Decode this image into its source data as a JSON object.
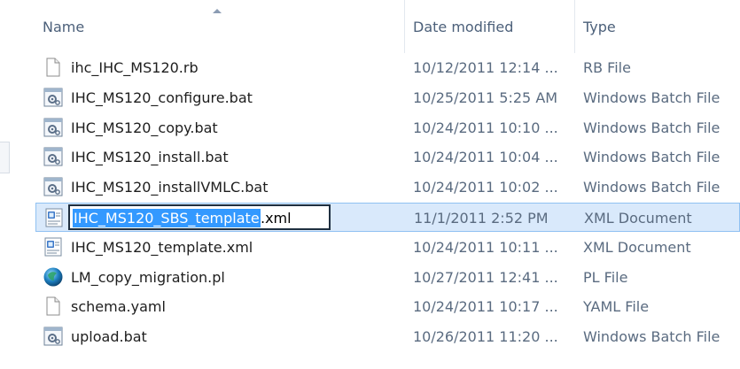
{
  "columns": {
    "name": "Name",
    "date_modified": "Date modified",
    "type": "Type"
  },
  "files": [
    {
      "name": "ihc_IHC_MS120.rb",
      "date": "10/12/2011 12:14 ...",
      "type": "RB File",
      "icon": "blank-file-icon"
    },
    {
      "name": "IHC_MS120_configure.bat",
      "date": "10/25/2011 5:25 AM",
      "type": "Windows Batch File",
      "icon": "batch-file-icon"
    },
    {
      "name": "IHC_MS120_copy.bat",
      "date": "10/24/2011 10:10 ...",
      "type": "Windows Batch File",
      "icon": "batch-file-icon"
    },
    {
      "name": "IHC_MS120_install.bat",
      "date": "10/24/2011 10:04 ...",
      "type": "Windows Batch File",
      "icon": "batch-file-icon"
    },
    {
      "name": "IHC_MS120_installVMLC.bat",
      "date": "10/24/2011 10:02 ...",
      "type": "Windows Batch File",
      "icon": "batch-file-icon"
    },
    {
      "name_selected": "IHC_MS120_SBS_template",
      "name_rest": ".xml",
      "date": "11/1/2011 2:52 PM",
      "type": "XML Document",
      "icon": "xml-file-icon",
      "selected": true,
      "renaming": true
    },
    {
      "name": "IHC_MS120_template.xml",
      "date": "10/24/2011 10:11 ...",
      "type": "XML Document",
      "icon": "xml-file-icon"
    },
    {
      "name": "LM_copy_migration.pl",
      "date": "10/27/2011 12:41 ...",
      "type": "PL File",
      "icon": "perl-file-icon"
    },
    {
      "name": "schema.yaml",
      "date": "10/24/2011 10:17 ...",
      "type": "YAML File",
      "icon": "blank-file-icon"
    },
    {
      "name": "upload.bat",
      "date": "10/26/2011 11:20 ...",
      "type": "Windows Batch File",
      "icon": "batch-file-icon"
    }
  ],
  "colors": {
    "selection_bg": "#d9e9fb",
    "selection_border": "#90c1f2",
    "text_highlight": "#3399ff",
    "header_text": "#4c607a"
  }
}
